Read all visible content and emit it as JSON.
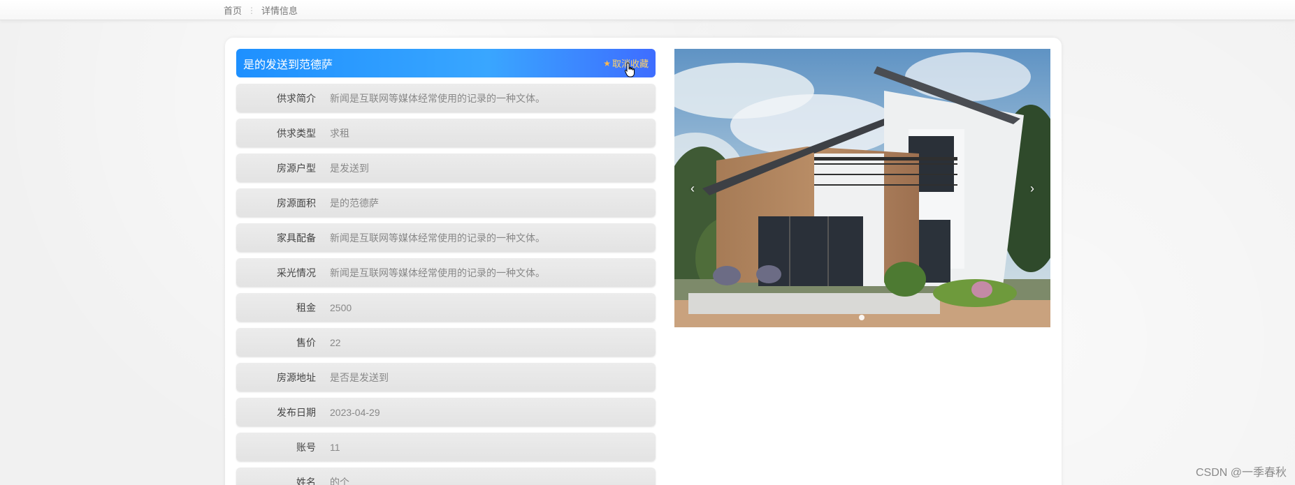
{
  "breadcrumb": {
    "home": "首页",
    "separator": "⋮",
    "current": "详情信息"
  },
  "detail": {
    "title": "是的发送到范德萨",
    "favorite_label": "取消收藏",
    "favorite_icon": "star-icon",
    "rows": [
      {
        "label": "供求简介",
        "value": "新闻是互联网等媒体经常使用的记录的一种文体。"
      },
      {
        "label": "供求类型",
        "value": "求租"
      },
      {
        "label": "房源户型",
        "value": "是发送到"
      },
      {
        "label": "房源面积",
        "value": "是的范德萨"
      },
      {
        "label": "家具配备",
        "value": "新闻是互联网等媒体经常使用的记录的一种文体。"
      },
      {
        "label": "采光情况",
        "value": "新闻是互联网等媒体经常使用的记录的一种文体。"
      },
      {
        "label": "租金",
        "value": "2500"
      },
      {
        "label": "售价",
        "value": "22"
      },
      {
        "label": "房源地址",
        "value": "是否是发送到"
      },
      {
        "label": "发布日期",
        "value": "2023-04-29"
      },
      {
        "label": "账号",
        "value": "11"
      },
      {
        "label": "姓名",
        "value": "的个"
      }
    ]
  },
  "carousel": {
    "prev_icon": "‹",
    "next_icon": "›"
  },
  "watermark": "CSDN @一季春秋",
  "colors": {
    "title_gradient_start": "#1e90ff",
    "title_gradient_end": "#3e6dff",
    "favorite_text": "#ffd56a"
  }
}
